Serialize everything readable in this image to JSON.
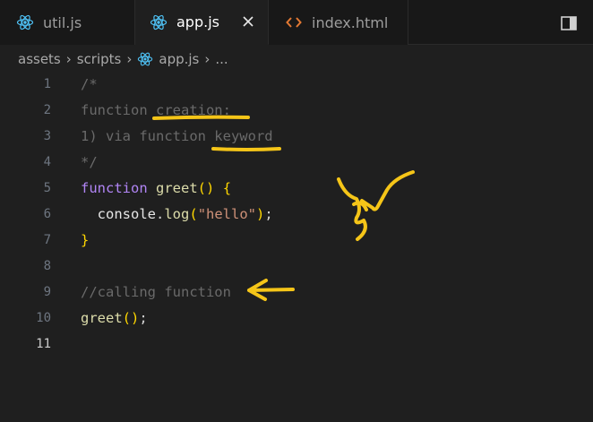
{
  "tabs": [
    {
      "label": "util.js",
      "icon": "react-icon",
      "active": false
    },
    {
      "label": "app.js",
      "icon": "react-icon",
      "active": true
    },
    {
      "label": "index.html",
      "icon": "html-code-icon",
      "active": false
    }
  ],
  "breadcrumb": {
    "items": [
      "assets",
      "scripts",
      "app.js",
      "..."
    ]
  },
  "editor": {
    "current_line": 11,
    "lines": [
      {
        "n": "1",
        "tokens": [
          {
            "t": "/*",
            "c": "comment"
          }
        ]
      },
      {
        "n": "2",
        "tokens": [
          {
            "t": "function creation:",
            "c": "comment"
          }
        ]
      },
      {
        "n": "3",
        "tokens": [
          {
            "t": "1) via function keyword",
            "c": "comment"
          }
        ]
      },
      {
        "n": "4",
        "tokens": [
          {
            "t": "*/",
            "c": "comment"
          }
        ]
      },
      {
        "n": "5",
        "tokens": [
          {
            "t": "function",
            "c": "kw"
          },
          {
            "t": " ",
            "c": "pun"
          },
          {
            "t": "greet",
            "c": "fn"
          },
          {
            "t": "()",
            "c": "br"
          },
          {
            "t": " ",
            "c": "pun"
          },
          {
            "t": "{",
            "c": "br"
          }
        ]
      },
      {
        "n": "6",
        "tokens": [
          {
            "t": "  console",
            "c": "var"
          },
          {
            "t": ".",
            "c": "pun"
          },
          {
            "t": "log",
            "c": "fn"
          },
          {
            "t": "(",
            "c": "br"
          },
          {
            "t": "\"hello\"",
            "c": "str"
          },
          {
            "t": ")",
            "c": "br"
          },
          {
            "t": ";",
            "c": "pun"
          }
        ]
      },
      {
        "n": "7",
        "tokens": [
          {
            "t": "}",
            "c": "br"
          }
        ]
      },
      {
        "n": "8",
        "tokens": []
      },
      {
        "n": "9",
        "tokens": [
          {
            "t": "//calling function",
            "c": "comment"
          }
        ]
      },
      {
        "n": "10",
        "tokens": [
          {
            "t": "greet",
            "c": "fn"
          },
          {
            "t": "()",
            "c": "br"
          },
          {
            "t": ";",
            "c": "pun"
          }
        ]
      },
      {
        "n": "11",
        "tokens": []
      }
    ]
  },
  "colors": {
    "background": "#1f1f1f",
    "annotation_ink": "#f5c518",
    "react_icon": "#4fc3f7",
    "html_icon": "#e37933"
  }
}
